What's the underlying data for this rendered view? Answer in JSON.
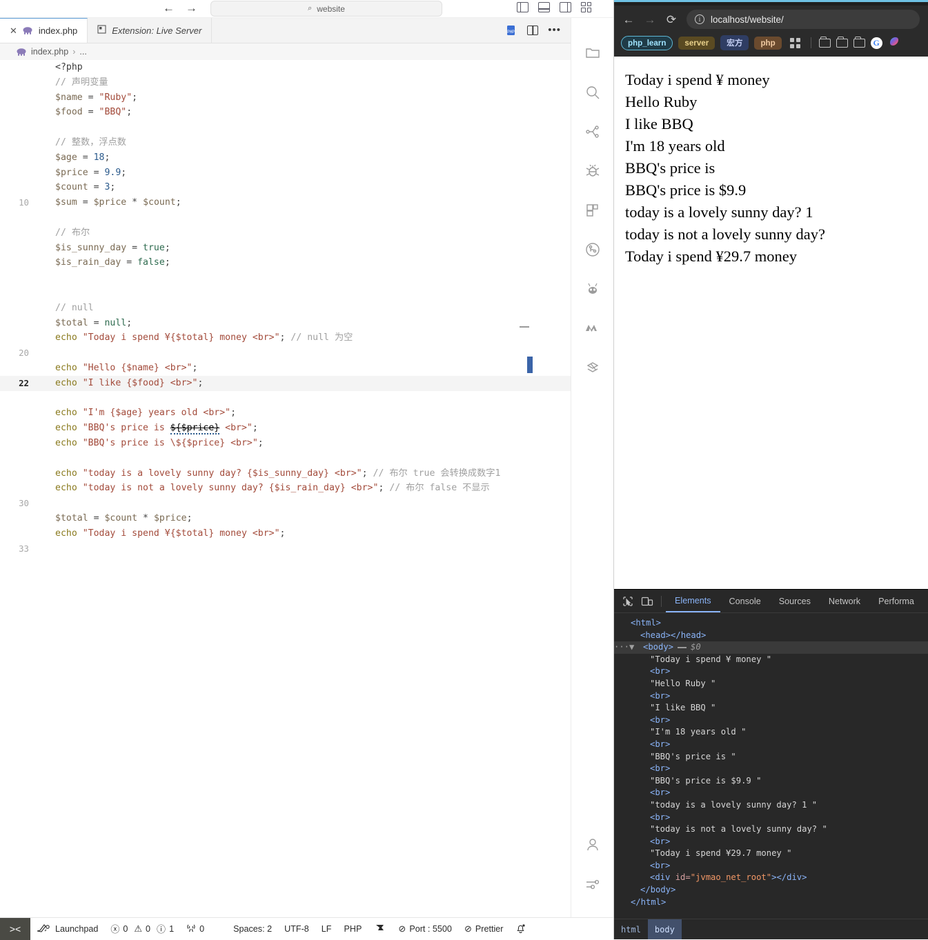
{
  "vscode": {
    "window": {
      "nav_back": "←",
      "nav_forward": "→",
      "command_center_placeholder": "website",
      "search_icon": "⌕",
      "layout_icons": [
        "toggle-primary-sidebar",
        "toggle-panel",
        "toggle-secondary-sidebar",
        "customize-layout"
      ]
    },
    "tabs": [
      {
        "label": "index.php",
        "close": "✕",
        "active": true,
        "preview": false
      },
      {
        "label": "Extension: Live Server",
        "active": false,
        "preview": true
      }
    ],
    "tab_actions": [
      "php-preview-icon",
      "split-editor-icon",
      "more-actions-icon"
    ],
    "breadcrumb": {
      "file": "index.php",
      "separator": "›",
      "rest": "..."
    },
    "editor": {
      "lines": [
        {
          "num": "",
          "tokens": [
            [
              "tag",
              "<?php"
            ]
          ]
        },
        {
          "num": "",
          "tokens": [
            [
              "com",
              "// 声明变量"
            ]
          ]
        },
        {
          "num": "",
          "tokens": [
            [
              "var",
              "$name"
            ],
            [
              "op",
              " = "
            ],
            [
              "str",
              "\"Ruby\""
            ],
            [
              "op",
              ";"
            ]
          ]
        },
        {
          "num": "",
          "tokens": [
            [
              "var",
              "$food"
            ],
            [
              "op",
              " = "
            ],
            [
              "str",
              "\"BBQ\""
            ],
            [
              "op",
              ";"
            ]
          ]
        },
        {
          "num": "",
          "tokens": []
        },
        {
          "num": "",
          "tokens": [
            [
              "com",
              "// 整数，浮点数"
            ]
          ]
        },
        {
          "num": "",
          "tokens": [
            [
              "var",
              "$age"
            ],
            [
              "op",
              " = "
            ],
            [
              "num",
              "18"
            ],
            [
              "op",
              ";"
            ]
          ]
        },
        {
          "num": "",
          "tokens": [
            [
              "var",
              "$price"
            ],
            [
              "op",
              " = "
            ],
            [
              "num",
              "9.9"
            ],
            [
              "op",
              ";"
            ]
          ]
        },
        {
          "num": "",
          "tokens": [
            [
              "var",
              "$count"
            ],
            [
              "op",
              " = "
            ],
            [
              "num",
              "3"
            ],
            [
              "op",
              ";"
            ]
          ]
        },
        {
          "num": "10",
          "tokens": [
            [
              "var",
              "$sum"
            ],
            [
              "op",
              " = "
            ],
            [
              "var",
              "$price"
            ],
            [
              "op",
              " * "
            ],
            [
              "var",
              "$count"
            ],
            [
              "op",
              ";"
            ]
          ]
        },
        {
          "num": "",
          "tokens": []
        },
        {
          "num": "",
          "tokens": [
            [
              "com",
              "// 布尔"
            ]
          ]
        },
        {
          "num": "",
          "tokens": [
            [
              "var",
              "$is_sunny_day"
            ],
            [
              "op",
              " = "
            ],
            [
              "kw",
              "true"
            ],
            [
              "op",
              ";"
            ]
          ]
        },
        {
          "num": "",
          "tokens": [
            [
              "var",
              "$is_rain_day"
            ],
            [
              "op",
              " = "
            ],
            [
              "kw",
              "false"
            ],
            [
              "op",
              ";"
            ]
          ]
        },
        {
          "num": "",
          "tokens": []
        },
        {
          "num": "",
          "tokens": []
        },
        {
          "num": "",
          "tokens": [
            [
              "com",
              "// null"
            ]
          ]
        },
        {
          "num": "",
          "tokens": [
            [
              "var",
              "$total"
            ],
            [
              "op",
              " = "
            ],
            [
              "kw",
              "null"
            ],
            [
              "op",
              ";"
            ]
          ]
        },
        {
          "num": "",
          "tokens": [
            [
              "echo",
              "echo "
            ],
            [
              "str",
              "\"Today i spend ¥{$total} money <br>\""
            ],
            [
              "op",
              "; "
            ],
            [
              "com",
              "// null 为空"
            ]
          ]
        },
        {
          "num": "20",
          "tokens": []
        },
        {
          "num": "",
          "tokens": [
            [
              "echo",
              "echo "
            ],
            [
              "str",
              "\"Hello {$name} <br>\""
            ],
            [
              "op",
              ";"
            ]
          ]
        },
        {
          "num": "22",
          "active": true,
          "tokens": [
            [
              "echo",
              "echo "
            ],
            [
              "str",
              "\"I like {$food} <br>\""
            ],
            [
              "op",
              ";"
            ]
          ]
        },
        {
          "num": "",
          "tokens": []
        },
        {
          "num": "",
          "tokens": [
            [
              "echo",
              "echo "
            ],
            [
              "str",
              "\"I'm {$age} years old <br>\""
            ],
            [
              "op",
              ";"
            ]
          ]
        },
        {
          "num": "",
          "tokens": [
            [
              "echo",
              "echo "
            ],
            [
              "str",
              "\"BBQ's price is "
            ],
            [
              "err",
              "${$price}"
            ],
            [
              "str",
              " <br>\""
            ],
            [
              "op",
              ";"
            ]
          ]
        },
        {
          "num": "",
          "tokens": [
            [
              "echo",
              "echo "
            ],
            [
              "str",
              "\"BBQ's price is \\${$price} <br>\""
            ],
            [
              "op",
              ";"
            ]
          ]
        },
        {
          "num": "",
          "tokens": []
        },
        {
          "num": "",
          "tokens": [
            [
              "echo",
              "echo "
            ],
            [
              "str",
              "\"today is a lovely sunny day? {$is_sunny_day} <br>\""
            ],
            [
              "op",
              "; "
            ],
            [
              "com",
              "// 布尔 true 会转换成数字1"
            ]
          ]
        },
        {
          "num": "",
          "tokens": [
            [
              "echo",
              "echo "
            ],
            [
              "str",
              "\"today is not a lovely sunny day? {$is_rain_day} <br>\""
            ],
            [
              "op",
              "; "
            ],
            [
              "com",
              "// 布尔 false 不显示"
            ]
          ]
        },
        {
          "num": "30",
          "tokens": []
        },
        {
          "num": "",
          "tokens": [
            [
              "var",
              "$total"
            ],
            [
              "op",
              " = "
            ],
            [
              "var",
              "$count"
            ],
            [
              "op",
              " * "
            ],
            [
              "var",
              "$price"
            ],
            [
              "op",
              ";"
            ]
          ]
        },
        {
          "num": "",
          "tokens": [
            [
              "echo",
              "echo "
            ],
            [
              "str",
              "\"Today i spend ¥{$total} money <br>\""
            ],
            [
              "op",
              ";"
            ]
          ]
        },
        {
          "num": "33",
          "tokens": []
        }
      ]
    },
    "activitybar": {
      "top_icons": [
        "explorer-icon",
        "search-icon",
        "source-control-icon",
        "debug-icon",
        "extensions-icon",
        "git-graph-icon",
        "ant-design-icon",
        "marscode-icon",
        "remote-icon"
      ],
      "bottom_icons": [
        "account-icon",
        "settings-icon"
      ]
    },
    "statusbar": {
      "remote_icon": "><",
      "launchpad": "Launchpad",
      "errors": "0",
      "warnings": "0",
      "infos": "1",
      "radio": "0",
      "spaces": "Spaces: 2",
      "encoding": "UTF-8",
      "eol": "LF",
      "language": "PHP",
      "port": "Port : 5500",
      "prettier": "Prettier",
      "bell_icon": "bell-icon"
    }
  },
  "browser": {
    "toolbar": {
      "back": "←",
      "forward": "→",
      "reload": "⟳",
      "info_icon": "ⓘ",
      "url": "localhost/website/"
    },
    "bookmarks": [
      {
        "label": "php_learn",
        "style": "php_learn"
      },
      {
        "label": "server",
        "style": "server"
      },
      {
        "label": "宏方",
        "style": "hongfang"
      },
      {
        "label": "php",
        "style": "php"
      }
    ],
    "bookmark_icons": [
      "apps-grid-icon",
      "folder-icon",
      "folder-icon",
      "folder-icon",
      "google-icon",
      "copilot-icon"
    ],
    "page_lines": [
      "Today i spend ¥ money",
      "Hello Ruby",
      "I like BBQ",
      "I'm 18 years old",
      "BBQ's price is",
      "BBQ's price is $9.9",
      "today is a lovely sunny day? 1",
      "today is not a lovely sunny day?",
      "Today i spend ¥29.7 money"
    ],
    "devtools": {
      "icons": [
        "inspect-element-icon",
        "device-toolbar-icon"
      ],
      "tabs": [
        "Elements",
        "Console",
        "Sources",
        "Network",
        "Performa"
      ],
      "active_tab": "Elements",
      "dom": [
        {
          "type": "tag",
          "indent": 1,
          "text": "<html>"
        },
        {
          "type": "tag",
          "indent": 2,
          "text": "<head></head>"
        },
        {
          "type": "body",
          "indent": 2,
          "text": "<body>",
          "marker": "$0",
          "selected": true
        },
        {
          "type": "text",
          "indent": 3,
          "text": "\"Today i spend ¥ money \""
        },
        {
          "type": "tag",
          "indent": 3,
          "text": "<br>"
        },
        {
          "type": "text",
          "indent": 3,
          "text": "\"Hello Ruby \""
        },
        {
          "type": "tag",
          "indent": 3,
          "text": "<br>"
        },
        {
          "type": "text",
          "indent": 3,
          "text": "\"I like BBQ \""
        },
        {
          "type": "tag",
          "indent": 3,
          "text": "<br>"
        },
        {
          "type": "text",
          "indent": 3,
          "text": "\"I'm 18 years old \""
        },
        {
          "type": "tag",
          "indent": 3,
          "text": "<br>"
        },
        {
          "type": "text",
          "indent": 3,
          "text": "\"BBQ's price is \""
        },
        {
          "type": "tag",
          "indent": 3,
          "text": "<br>"
        },
        {
          "type": "text",
          "indent": 3,
          "text": "\"BBQ's price is $9.9 \""
        },
        {
          "type": "tag",
          "indent": 3,
          "text": "<br>"
        },
        {
          "type": "text",
          "indent": 3,
          "text": "\"today is a lovely sunny day? 1 \""
        },
        {
          "type": "tag",
          "indent": 3,
          "text": "<br>"
        },
        {
          "type": "text",
          "indent": 3,
          "text": "\"today is not a lovely sunny day? \""
        },
        {
          "type": "tag",
          "indent": 3,
          "text": "<br>"
        },
        {
          "type": "text",
          "indent": 3,
          "text": "\"Today i spend ¥29.7 money \""
        },
        {
          "type": "tag",
          "indent": 3,
          "text": "<br>"
        },
        {
          "type": "div",
          "indent": 3,
          "tag_open": "<div ",
          "attr": "id=",
          "attr_val": "\"jvmao_net_root\"",
          "tag_close": "></div>"
        },
        {
          "type": "tag",
          "indent": 2,
          "text": "</body>"
        },
        {
          "type": "tag",
          "indent": 1,
          "text": "</html>"
        }
      ],
      "breadcrumb": [
        "html",
        "body"
      ],
      "breadcrumb_active": "body"
    }
  },
  "colors": {
    "accent_blue": "#8ab4f8",
    "tab_active_border": "#5b9bd5",
    "devtools_bg": "#282828",
    "browser_chrome": "#2b2b2b"
  }
}
